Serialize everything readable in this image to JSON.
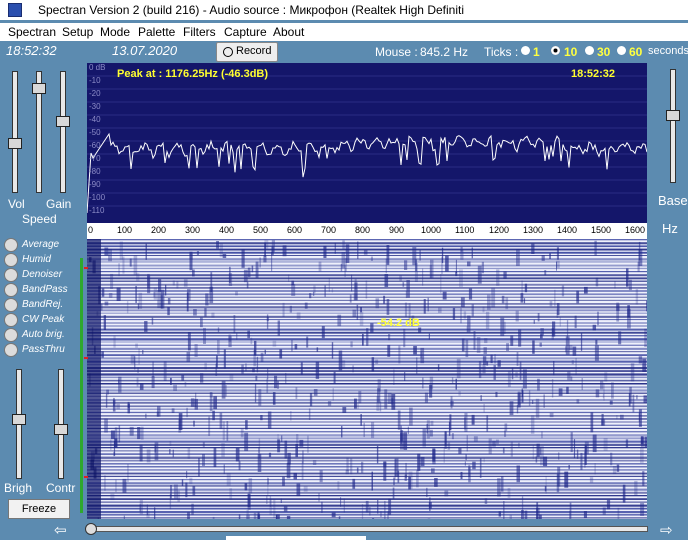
{
  "titlebar": {
    "title": "Spectran Version 2 (build 216) - Audio source : Микрофон (Realtek High Definiti"
  },
  "menu": [
    "Spectran",
    "Setup",
    "Mode",
    "Palette",
    "Filters",
    "Capture",
    "About"
  ],
  "toolbar": {
    "time": "18:52:32",
    "date": "13.07.2020",
    "record_label": "Record",
    "mouse_label": "Mouse :",
    "mouse_value": "845.2 Hz",
    "ticks_label": "Ticks :",
    "ticks": [
      "1",
      "10",
      "30",
      "60"
    ],
    "selected_tick": "10",
    "seconds_label": "seconds"
  },
  "left": {
    "vol_label": "Vol",
    "gain_label": "Gain",
    "speed_label": "Speed",
    "options": [
      "Average",
      "Humid",
      "Denoiser",
      "BandPass",
      "BandRej.",
      "CW Peak",
      "Auto brig.",
      "PassThru"
    ],
    "brigh_label": "Brigh",
    "contr_label": "Contr",
    "freeze_label": "Freeze",
    "levels": {
      "vol": 0.6,
      "gain": 0.4,
      "speed": 0.1,
      "brigh": 0.45,
      "contr": 0.55
    }
  },
  "graph": {
    "peak_text": "Peak at : 1176.25Hz (-46.3dB)",
    "clock_text": "18:52:32",
    "db_labels": [
      "0 dB",
      "-10",
      "-20",
      "-30",
      "-40",
      "-50",
      "-60",
      "-70",
      "-80",
      "-90",
      "-100",
      "-110"
    ],
    "x_labels": [
      "0",
      "100",
      "200",
      "300",
      "400",
      "500",
      "600",
      "700",
      "800",
      "900",
      "1000",
      "1100",
      "1200",
      "1300",
      "1400",
      "1500",
      "1600"
    ]
  },
  "spectrogram": {
    "annotation": "-54.2 dB"
  },
  "right": {
    "base_label": "Base",
    "hz_label": "Hz"
  },
  "colors": {
    "panel": "#5c8bb0",
    "graph_bg": "#14166a",
    "peak_text": "#ffff30",
    "spec_line": "#18207a"
  }
}
